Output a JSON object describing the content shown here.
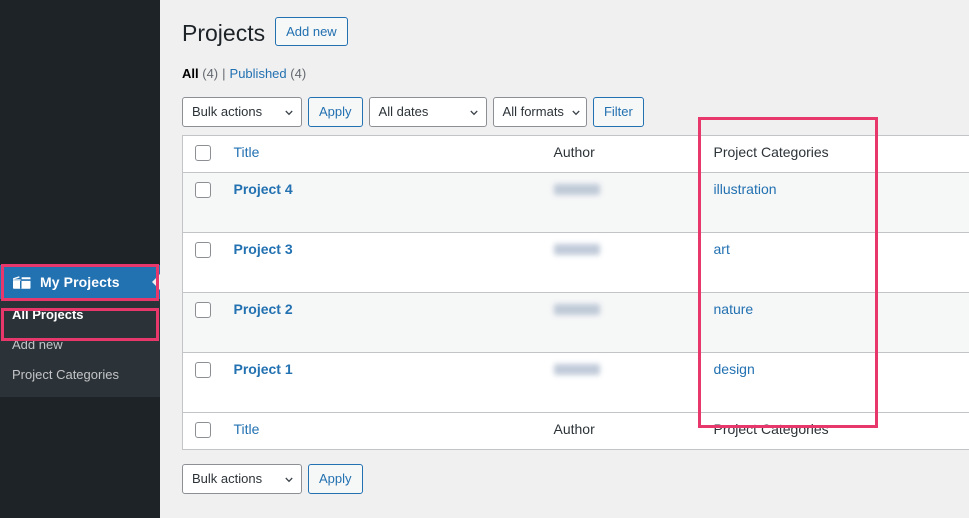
{
  "sidebar": {
    "menu": {
      "icon": "portfolio-folder-icon",
      "label": "My Projects",
      "arrow_icon": "left-arrow-icon",
      "active_color": "#2271b1"
    },
    "submenu": [
      {
        "label": "All Projects",
        "current": true
      },
      {
        "label": "Add new",
        "current": false
      },
      {
        "label": "Project Categories",
        "current": false
      }
    ]
  },
  "header": {
    "title": "Projects",
    "add_new_label": "Add new"
  },
  "views": {
    "all_label": "All",
    "all_count": "(4)",
    "separator": "|",
    "published_label": "Published",
    "published_count": "(4)"
  },
  "tablenav_top": {
    "bulk_actions": "Bulk actions",
    "apply_label": "Apply",
    "all_dates": "All dates",
    "all_formats": "All formats",
    "filter_label": "Filter",
    "chevron_icon": "chevron-down-icon"
  },
  "tablenav_bottom": {
    "bulk_actions": "Bulk actions",
    "apply_label": "Apply",
    "chevron_icon": "chevron-down-icon"
  },
  "table": {
    "columns": {
      "title": "Title",
      "author": "Author",
      "categories": "Project Categories"
    },
    "rows": [
      {
        "title": "Project 4",
        "author": "",
        "category": "illustration"
      },
      {
        "title": "Project 3",
        "author": "",
        "category": "art"
      },
      {
        "title": "Project 2",
        "author": "",
        "category": "nature"
      },
      {
        "title": "Project 1",
        "author": "",
        "category": "design"
      }
    ]
  },
  "annotations": {
    "highlight_color": "#e8376b",
    "boxes": [
      "menu-item-my-projects",
      "submenu-item-all-projects",
      "project-categories-column"
    ]
  }
}
